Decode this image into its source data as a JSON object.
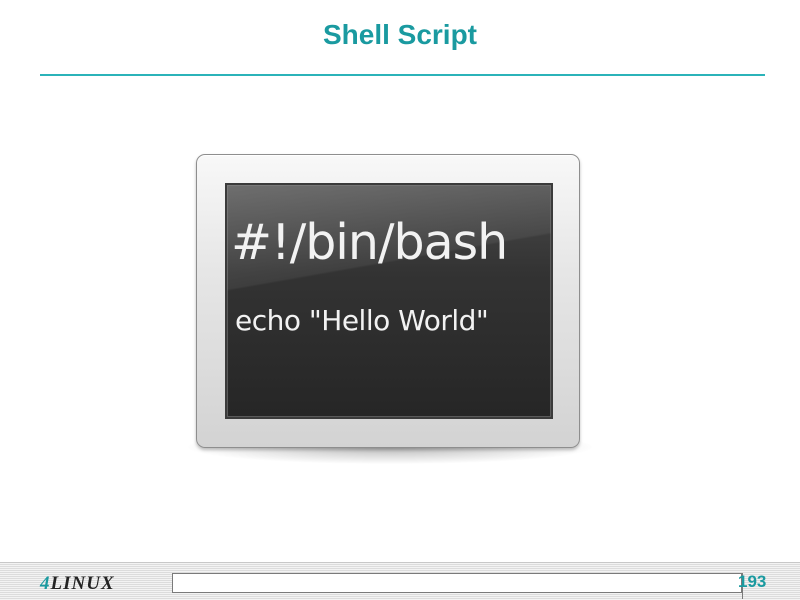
{
  "slide": {
    "title": "Shell Script",
    "accent_color": "#1a9aa0"
  },
  "terminal": {
    "icon": "terminal-icon",
    "line1": "#!/bin/bash",
    "line2": "echo \"Hello World\""
  },
  "footer": {
    "logo_num": "4",
    "logo_text": "LINUX",
    "page_number": "193"
  }
}
